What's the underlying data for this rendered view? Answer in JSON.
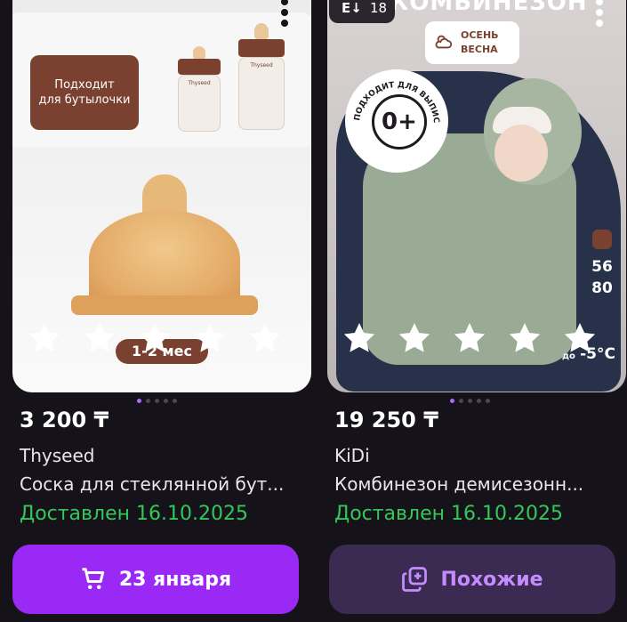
{
  "colors": {
    "background": "#161219",
    "accent_purple": "#9a29f5",
    "secondary_button": "#3b2a52",
    "secondary_text": "#c58cff",
    "delivered_green": "#34c759",
    "brand_brown": "#7a4130"
  },
  "products": [
    {
      "image": {
        "badge_text_line1": "Подходит",
        "badge_text_line2": "для бутылочки",
        "bottle_brand": "Thyseed",
        "age_label": "1-2 мес"
      },
      "rating_stars": 5,
      "carousel_pages": 5,
      "carousel_active": 0,
      "price": "3 200 ₸",
      "brand": "Thyseed",
      "name": "Соска для стеклянной бут...",
      "delivery_status": "Доставлен 16.10.2025",
      "action": {
        "label": "23 января",
        "icon": "cart-icon"
      }
    },
    {
      "image": {
        "sort_count": "18",
        "title_fragment": "КОМБИНЕЗОН",
        "season_line1": "ОСЕНЬ",
        "season_line2": "ВЕСНА",
        "age_badge": "0+",
        "age_badge_caption": "ПОДХОДИТ ДЛЯ ВЫПИСКИ",
        "size_from": "56",
        "size_to": "80",
        "temp_prefix": "до",
        "temp_value": "-5°C"
      },
      "rating_stars": 5,
      "carousel_pages": 5,
      "carousel_active": 0,
      "price": "19 250 ₸",
      "brand": "KiDi",
      "name": "Комбинезон демисезонн...",
      "delivery_status": "Доставлен 16.10.2025",
      "action": {
        "label": "Похожие",
        "icon": "similar-icon"
      }
    }
  ]
}
